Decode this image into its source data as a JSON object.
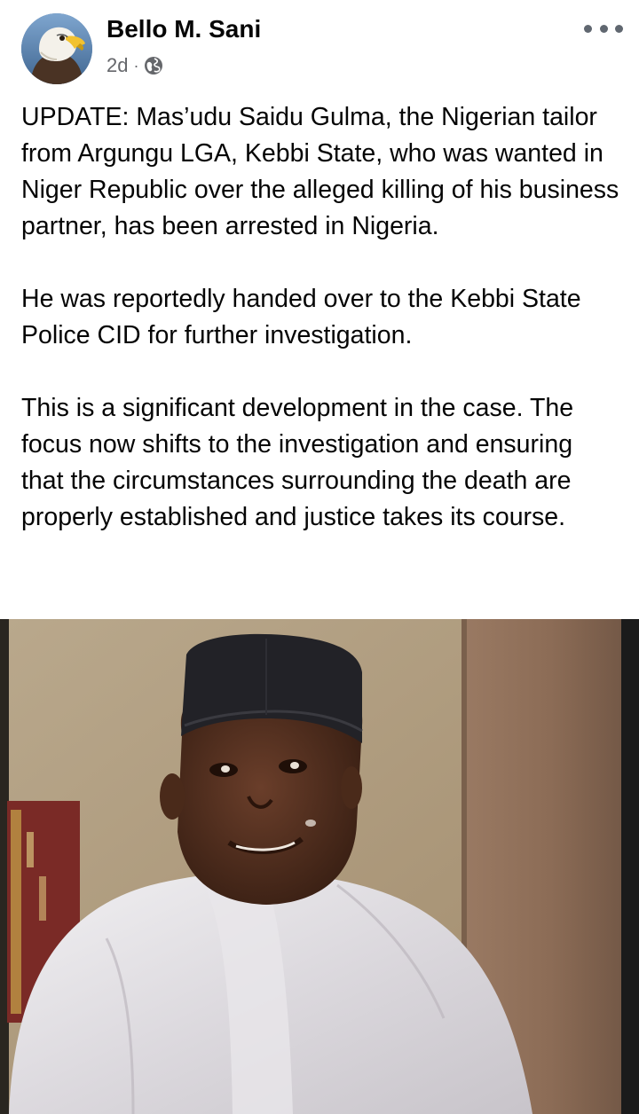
{
  "post": {
    "author": "Bello M. Sani",
    "time": "2d",
    "separator": "·",
    "audience_icon": "globe-icon",
    "more_icon": "more-options-icon",
    "paragraphs": [
      "UPDATE: Mas’udu Saidu Gulma, the Nigerian tailor from Argungu LGA, Kebbi State, who was wanted in Niger Republic over the alleged killing of his business partner, has been arrested in Nigeria.",
      "He was reportedly handed over to the Kebbi State Police CID for further investigation.",
      "This is a significant development in the case. The focus now shifts to the investigation and ensuring that the circumstances surrounding the death are properly established and justice takes its course."
    ],
    "avatar_icon": "eagle-avatar",
    "photo_icon": "portrait-photo"
  },
  "colors": {
    "text": "#050505",
    "secondary_text": "#65676b",
    "background": "#ffffff"
  }
}
